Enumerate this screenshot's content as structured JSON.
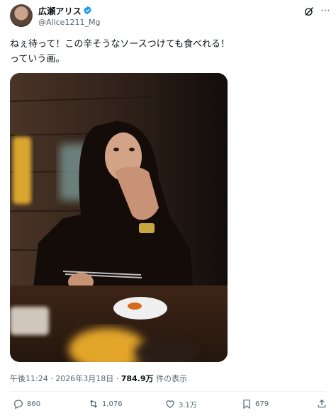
{
  "post": {
    "author_name": "広瀬アリス",
    "author_handle": "@Alice1211_Mg",
    "text_line1": "ねぇ待って！この辛そうなソースつけても食べれる！",
    "text_line2": "っていう画。",
    "time": "午後11:24",
    "separator": "·",
    "date": "2026年3月18日",
    "views_count": "784.9万",
    "views_label": "件の表示"
  },
  "actions": {
    "replies": "860",
    "reposts": "1,076",
    "likes": "3.1万",
    "bookmarks": "679"
  },
  "icons": {
    "verified": "verified-badge-icon",
    "grok": "grok-icon",
    "more": "more-icon",
    "reply": "reply-icon",
    "repost": "repost-icon",
    "like": "like-icon",
    "bookmark": "bookmark-icon",
    "share": "share-icon"
  },
  "colors": {
    "verified": "#1d9bf0",
    "secondary_text": "#536471",
    "primary_text": "#0f1419"
  }
}
